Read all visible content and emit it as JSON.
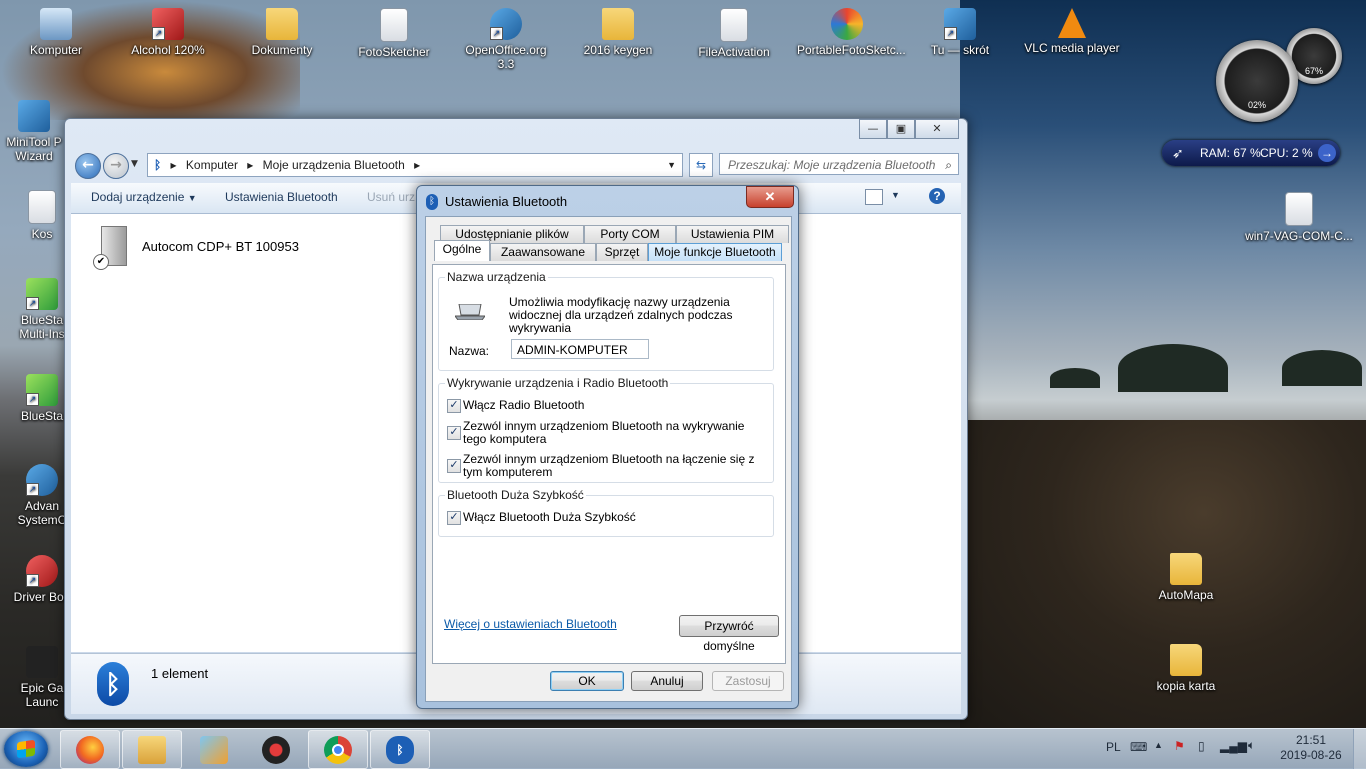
{
  "desktop": {
    "top_icons": [
      {
        "label": "Komputer",
        "icon": "computer-icon"
      },
      {
        "label": "Alcohol 120%",
        "icon": "alcohol-icon"
      },
      {
        "label": "Dokumenty",
        "icon": "folder-icon"
      },
      {
        "label": "FotoSketcher",
        "icon": "fotosketcher-icon"
      },
      {
        "label": "OpenOffice.org 3.3",
        "icon": "openoffice-icon"
      },
      {
        "label": "2016 keygen",
        "icon": "folder-icon"
      },
      {
        "label": "FileActivation",
        "icon": "document-icon"
      },
      {
        "label": "PortableFotoSketc...",
        "icon": "fotosketcher-icon"
      },
      {
        "label": "Tu — skrót",
        "icon": "shortcut-icon"
      },
      {
        "label": "VLC media player",
        "icon": "vlc-icon"
      }
    ],
    "left_icons": [
      {
        "label": "MiniTool P\nWizard",
        "icon": "minitool-icon"
      },
      {
        "label": "Kos",
        "icon": "recycle-bin-icon"
      },
      {
        "label": "BlueSta\nMulti-Ins",
        "icon": "bluestacks-icon"
      },
      {
        "label": "BlueSta",
        "icon": "bluestacks-icon"
      },
      {
        "label": "Advan\nSystemC",
        "icon": "advanced-systemcare-icon"
      },
      {
        "label": "Driver Boo",
        "icon": "driver-booster-icon"
      },
      {
        "label": "Epic Ga\nLaunc",
        "icon": "epic-games-icon"
      }
    ],
    "right_icons": [
      {
        "label": "win7-VAG-COM-C...",
        "icon": "settings-file-icon"
      },
      {
        "label": "AutoMapa",
        "icon": "folder-icon"
      },
      {
        "label": "kopia karta",
        "icon": "folder-icon"
      }
    ],
    "gadget": {
      "cpu_gauge": "02%",
      "ram_gauge": "67%",
      "ram_text": "RAM: 67 %",
      "cpu_text": "CPU: 2 %"
    }
  },
  "explorer": {
    "breadcrumb": [
      "Komputer",
      "Moje urządzenia Bluetooth"
    ],
    "search_placeholder": "Przeszukaj: Moje urządzenia Bluetooth",
    "toolbar": {
      "add_device": "Dodaj urządzenie",
      "bt_settings": "Ustawienia Bluetooth",
      "remove": "Usuń urz"
    },
    "device_name": "Autocom CDP+ BT 100953",
    "status": "1 element"
  },
  "dialog": {
    "title": "Ustawienia Bluetooth",
    "tabs_back": [
      "Udostępnianie plików",
      "Porty COM",
      "Ustawienia PIM"
    ],
    "tabs_front": [
      "Ogólne",
      "Zaawansowane",
      "Sprzęt",
      "Moje funkcje Bluetooth"
    ],
    "group_name": {
      "title": "Nazwa urządzenia",
      "description": "Umożliwia modyfikację nazwy urządzenia widocznej dla urządzeń zdalnych podczas wykrywania",
      "name_label": "Nazwa:",
      "name_value": "ADMIN-KOMPUTER"
    },
    "group_discovery": {
      "title": "Wykrywanie urządzenia i Radio Bluetooth",
      "options": [
        {
          "label": "Włącz Radio Bluetooth",
          "checked": true
        },
        {
          "label": "Zezwól innym urządzeniom Bluetooth na wykrywanie tego komputera",
          "checked": true
        },
        {
          "label": "Zezwól innym urządzeniom Bluetooth na łączenie się z tym komputerem",
          "checked": true
        }
      ]
    },
    "group_highspeed": {
      "title": "Bluetooth Duża Szybkość",
      "options": [
        {
          "label": "Włącz Bluetooth Duża Szybkość",
          "checked": true
        }
      ]
    },
    "more_link": "Więcej o ustawieniach Bluetooth",
    "restore_button": "Przywróć domyślne",
    "ok": "OK",
    "cancel": "Anuluj",
    "apply": "Zastosuj"
  },
  "taskbar": {
    "apps": [
      "firefox-icon",
      "explorer-icon",
      "media-player-icon",
      "gaming-app-icon",
      "chrome-icon",
      "bluetooth-icon"
    ],
    "language": "PL",
    "time": "21:51",
    "date": "2019-08-26"
  }
}
